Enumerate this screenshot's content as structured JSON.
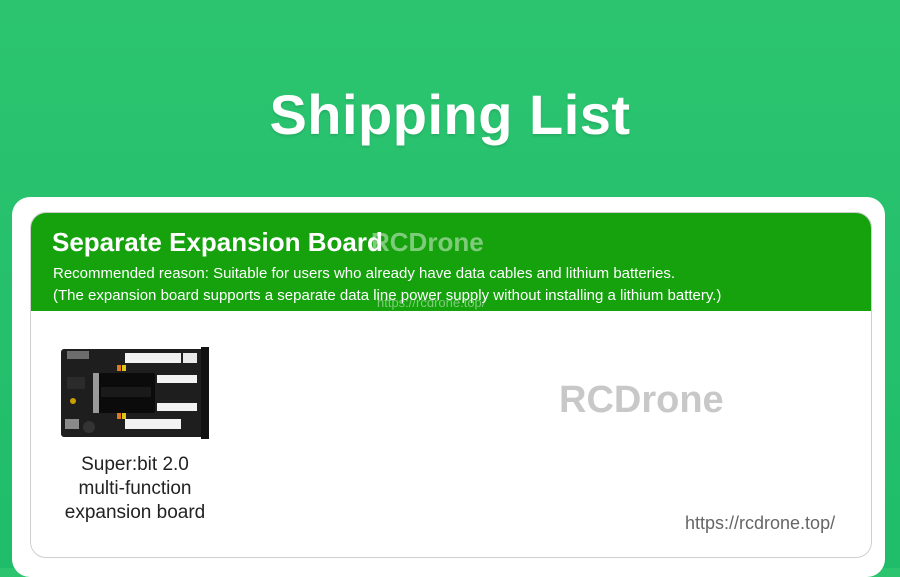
{
  "page": {
    "title": "Shipping List"
  },
  "section": {
    "title": "Separate Expansion Board",
    "reason_line1": "Recommended reason: Suitable for users who already have data cables and lithium batteries.",
    "reason_line2": "(The expansion board supports a separate data line power supply without installing a lithium battery.)"
  },
  "item": {
    "caption_line1": "Super:bit 2.0",
    "caption_line2": "multi-function",
    "caption_line3": "expansion board"
  },
  "watermark": {
    "brand": "RCDrone",
    "url": "https://rcdrone.top/"
  },
  "colors": {
    "background": "#22c06c",
    "header_band": "#15a20d",
    "card": "#ffffff"
  }
}
